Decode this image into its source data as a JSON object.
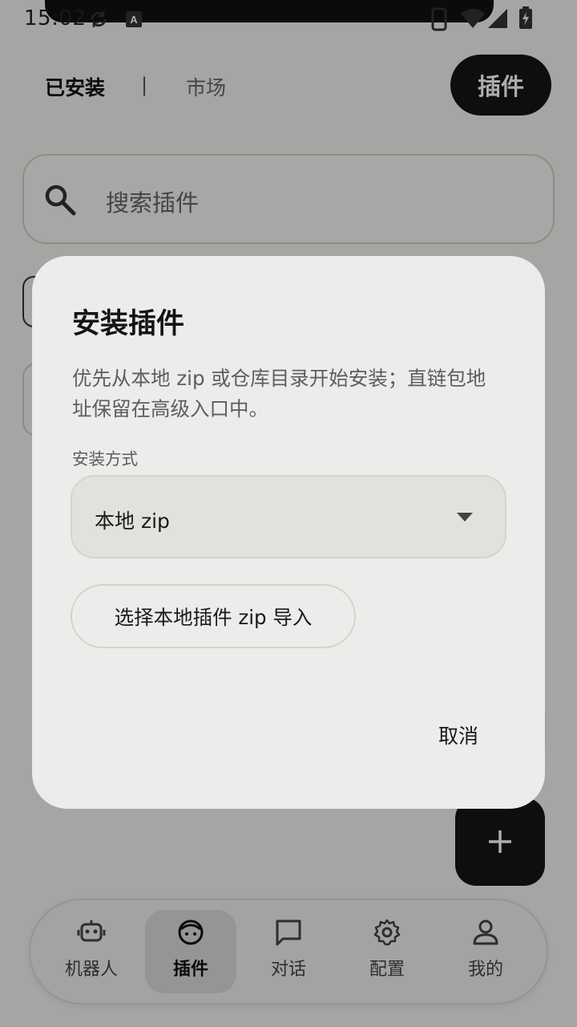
{
  "status_bar": {
    "time": "15:02"
  },
  "header": {
    "tab_installed": "已安装",
    "tab_divider": "|",
    "tab_market": "市场",
    "title": "插件"
  },
  "search": {
    "placeholder": "搜索插件"
  },
  "bottom_nav": {
    "items": [
      {
        "label": "机器人",
        "icon": "robot-icon"
      },
      {
        "label": "插件",
        "icon": "plugin-icon",
        "active": true
      },
      {
        "label": "对话",
        "icon": "chat-icon"
      },
      {
        "label": "配置",
        "icon": "gear-icon"
      },
      {
        "label": "我的",
        "icon": "person-icon"
      }
    ]
  },
  "dialog": {
    "title": "安装插件",
    "description": "优先从本地 zip 或仓库目录开始安装；直链包地址保留在高级入口中。",
    "method_label": "安装方式",
    "method_value": "本地 zip",
    "import_button": "选择本地插件 zip 导入",
    "cancel_button": "取消"
  },
  "fab": {
    "icon": "plus-icon"
  }
}
